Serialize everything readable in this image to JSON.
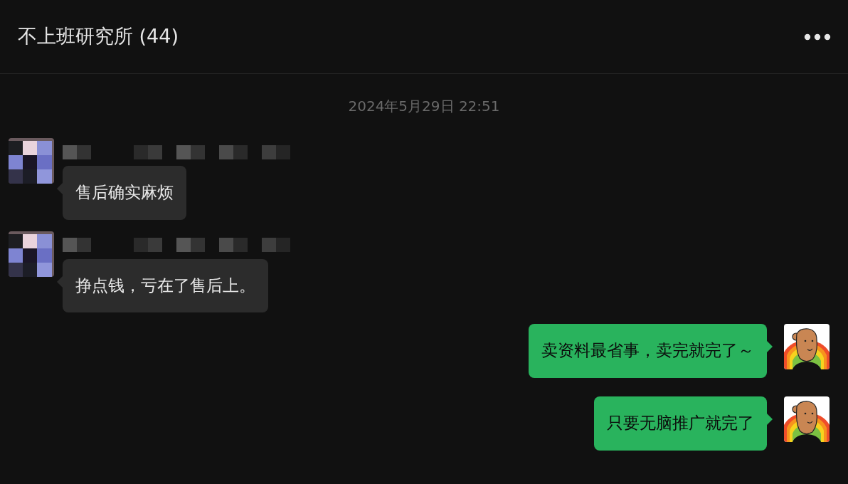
{
  "header": {
    "title": "不上班研究所 (44)"
  },
  "timestamp": "2024年5月29日 22:51",
  "messages": [
    {
      "kind": "received",
      "text": "售后确实麻烦"
    },
    {
      "kind": "received",
      "text": "挣点钱，亏在了售后上。"
    },
    {
      "kind": "sent",
      "text": "卖资料最省事，卖完就完了～"
    },
    {
      "kind": "sent",
      "text": "只要无脑推广就完了"
    }
  ]
}
